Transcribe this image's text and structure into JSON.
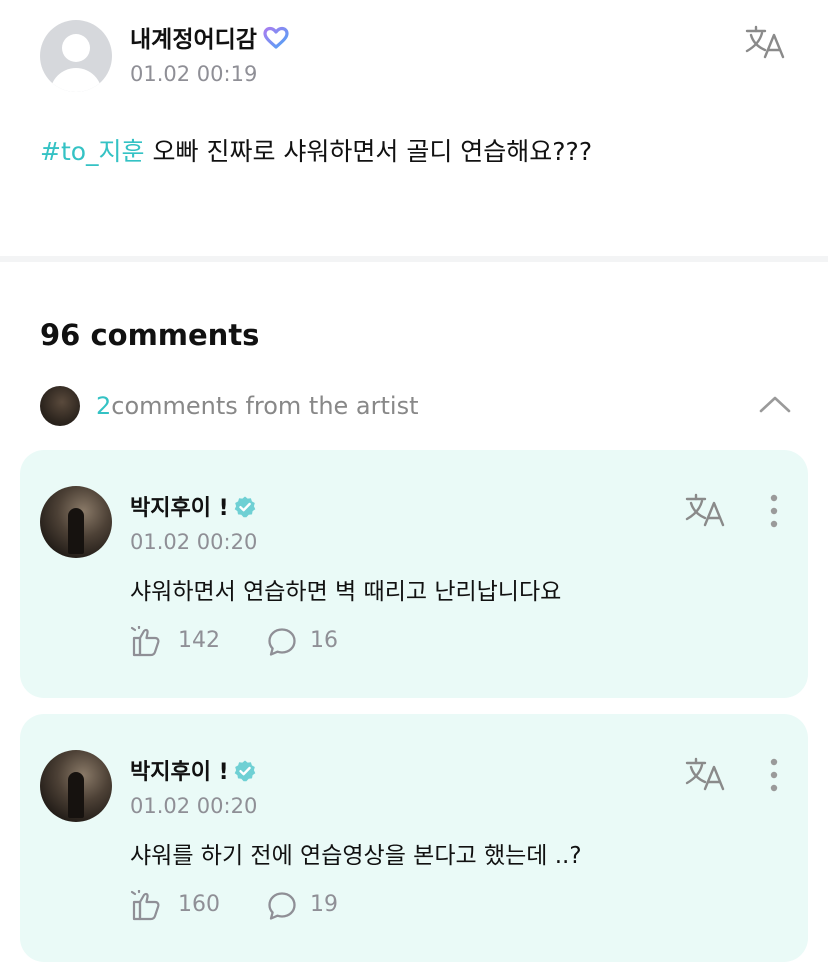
{
  "post": {
    "author": "내계정어디감",
    "time": "01.02 00:19",
    "hashtag": "#to_지훈",
    "text": " 오빠 진짜로 샤워하면서 골디 연습해요???"
  },
  "comments_header": "96 comments",
  "artist_row": {
    "count": "2",
    "label": "comments from the artist"
  },
  "comments": [
    {
      "name": "박지후이 !",
      "time": "01.02 00:20",
      "text": "샤워하면서 연습하면 벽 때리고 난리납니다요",
      "likes": "142",
      "replies": "16"
    },
    {
      "name": "박지후이 !",
      "time": "01.02 00:20",
      "text": "샤워를 하기 전에 연습영상을 본다고 했는데 ..?",
      "likes": "160",
      "replies": "19"
    }
  ],
  "colors": {
    "accent": "#34c2c4",
    "card_background": "#eafaf7",
    "muted_text": "#8f8f96"
  },
  "icons": [
    "translate-icon",
    "heart-badge-icon",
    "verified-badge-icon",
    "chevron-up-icon",
    "more-vertical-icon",
    "like-icon",
    "comment-icon"
  ]
}
